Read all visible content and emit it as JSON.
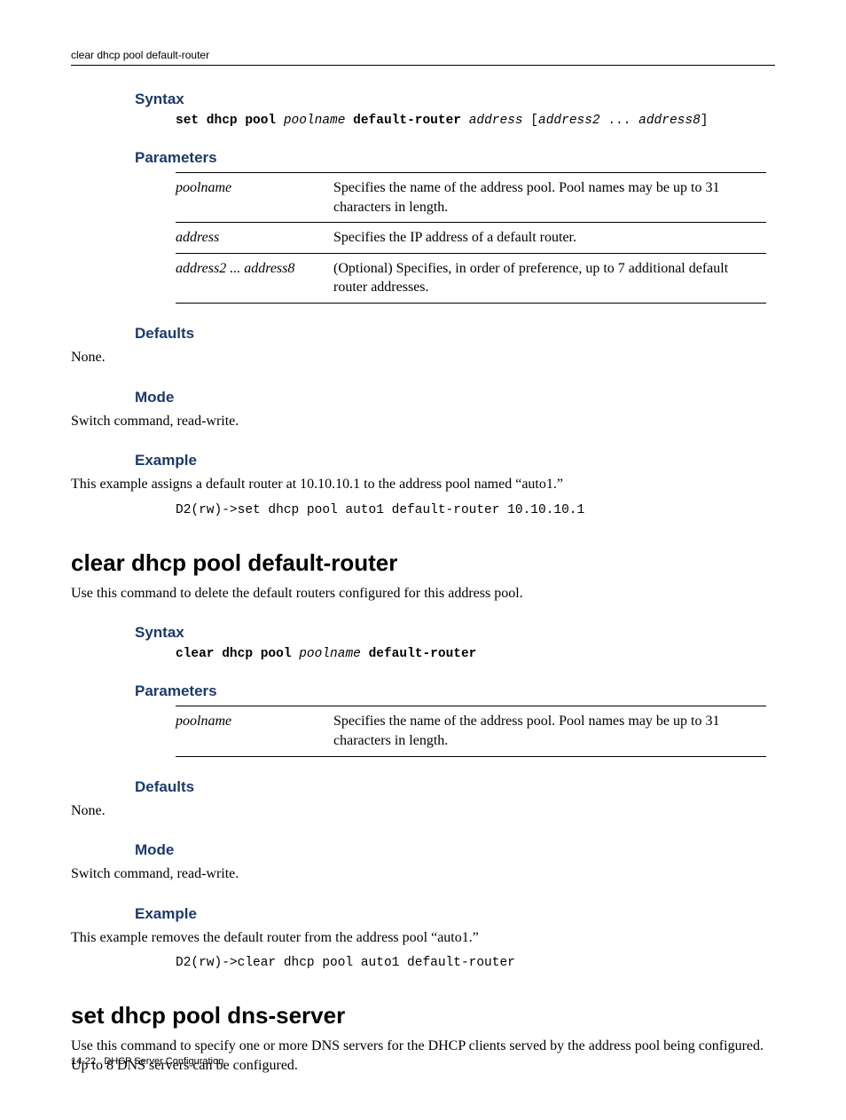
{
  "header": {
    "running": "clear dhcp pool default-router"
  },
  "s1": {
    "syntax_head": "Syntax",
    "syntax_line": "set dhcp pool poolname default-router address [address2 ... address8]",
    "params_head": "Parameters",
    "params": [
      {
        "name": "poolname",
        "desc": "Specifies the name of the address pool. Pool names may be up to 31 characters in length."
      },
      {
        "name": "address",
        "desc": "Specifies the IP address of a default router."
      },
      {
        "name": "address2 ... address8",
        "desc": "(Optional) Specifies, in order of preference, up to 7 additional default router addresses."
      }
    ],
    "defaults_head": "Defaults",
    "defaults_body": "None.",
    "mode_head": "Mode",
    "mode_body": "Switch command, read-write.",
    "example_head": "Example",
    "example_intro": "This example assigns a default router at 10.10.10.1 to the address pool named “auto1.”",
    "example_code": "D2(rw)->set dhcp pool auto1 default-router 10.10.10.1"
  },
  "cmd2": {
    "title": "clear dhcp pool default-router",
    "intro": "Use this command to delete the default routers configured for this address pool.",
    "syntax_head": "Syntax",
    "syntax_line": "clear dhcp pool poolname default-router",
    "params_head": "Parameters",
    "params": [
      {
        "name": "poolname",
        "desc": "Specifies the name of the address pool. Pool names may be up to 31 characters in length."
      }
    ],
    "defaults_head": "Defaults",
    "defaults_body": "None.",
    "mode_head": "Mode",
    "mode_body": "Switch command, read-write.",
    "example_head": "Example",
    "example_intro": "This example removes the default router from the address pool “auto1.”",
    "example_code": "D2(rw)->clear dhcp pool auto1 default-router"
  },
  "cmd3": {
    "title": "set dhcp pool dns-server",
    "intro": "Use this command to specify one or more DNS servers for the DHCP clients served by the address pool being configured. Up to 8 DNS servers can be configured."
  },
  "footer": {
    "page": "14-22",
    "chapter": "DHCP Server Configuration"
  }
}
